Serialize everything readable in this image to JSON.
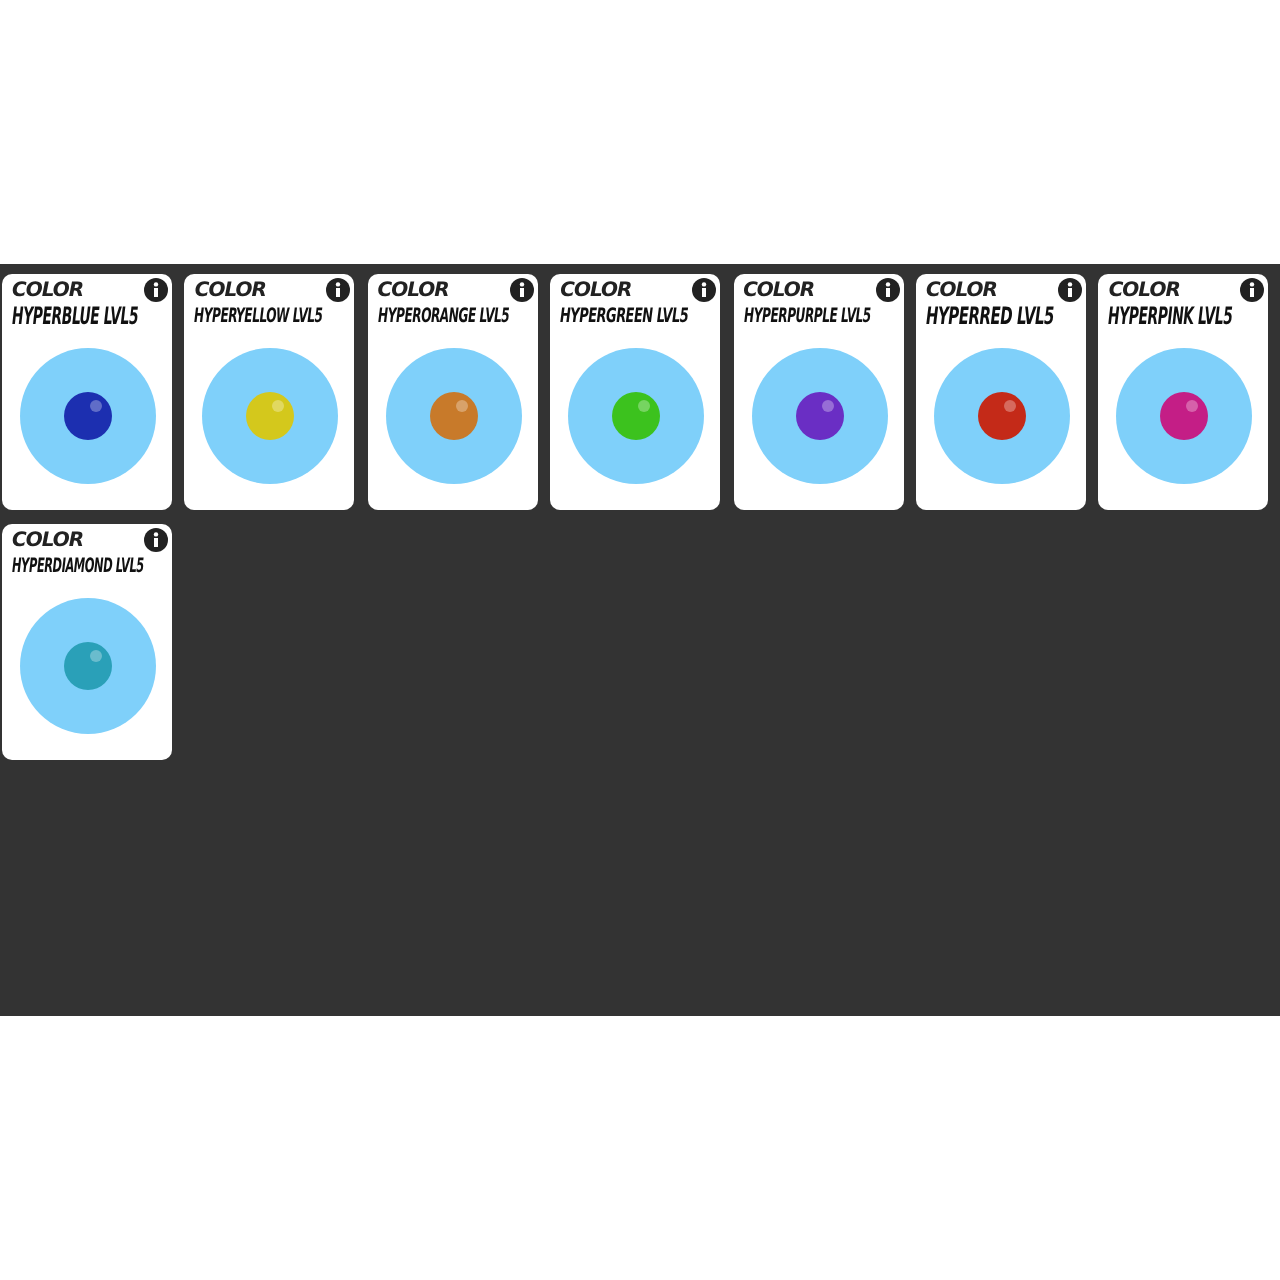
{
  "cards": [
    {
      "category": "COLOR",
      "name": "HYPERBLUE LVL5",
      "color": "#1c2fb0"
    },
    {
      "category": "COLOR",
      "name": "HYPERYELLOW LVL5",
      "color": "#d4c81c"
    },
    {
      "category": "COLOR",
      "name": "HYPERORANGE LVL5",
      "color": "#c87a2a"
    },
    {
      "category": "COLOR",
      "name": "HYPERGREEN LVL5",
      "color": "#3cc21e"
    },
    {
      "category": "COLOR",
      "name": "HYPERPURPLE LVL5",
      "color": "#6a2ec4"
    },
    {
      "category": "COLOR",
      "name": "HYPERRED LVL5",
      "color": "#c42a18"
    },
    {
      "category": "COLOR",
      "name": "HYPERPINK LVL5",
      "color": "#c41e86"
    },
    {
      "category": "COLOR",
      "name": "HYPERDIAMOND LVL5",
      "color": "#2aa0b8"
    }
  ]
}
